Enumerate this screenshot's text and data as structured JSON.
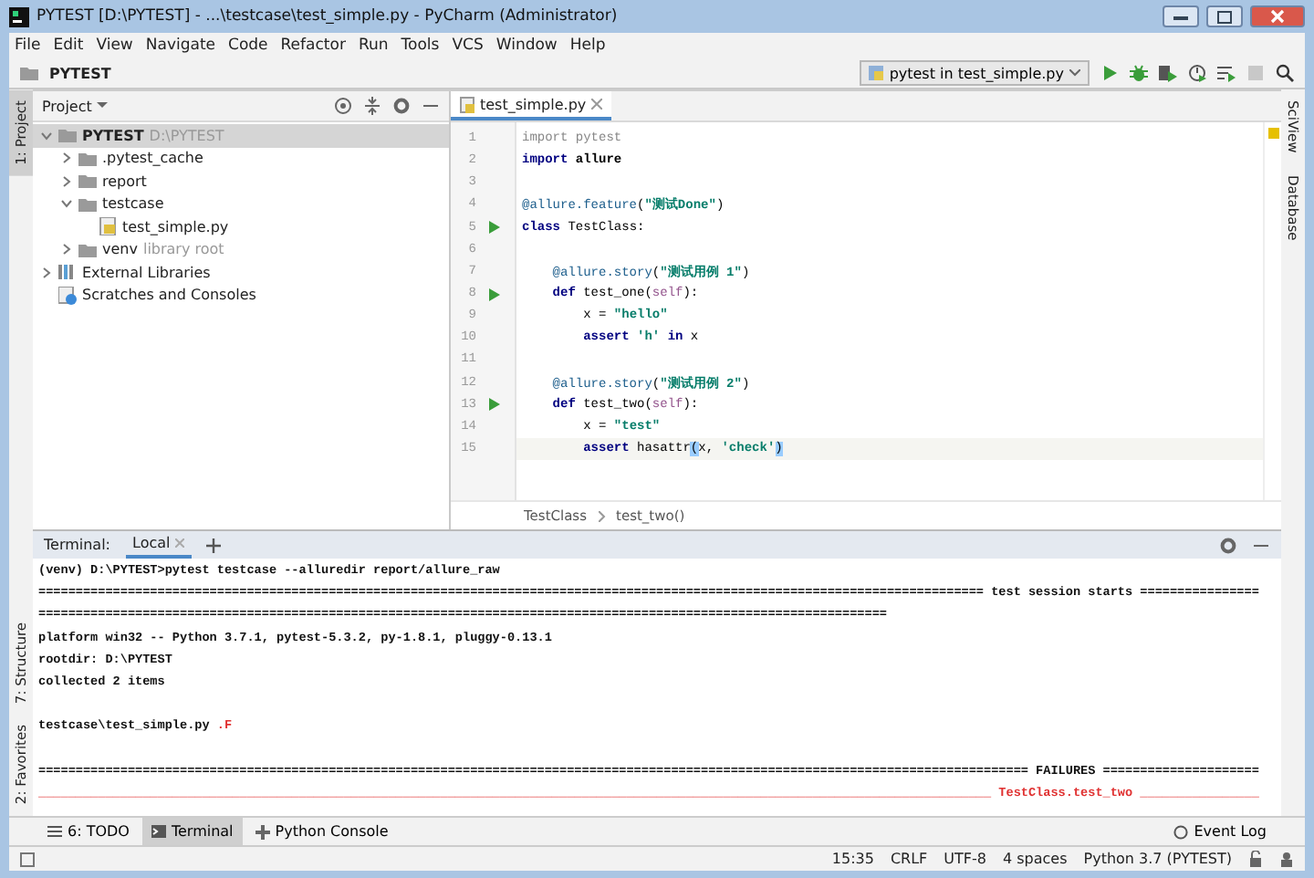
{
  "window": {
    "title": "PYTEST [D:\\PYTEST] - ...\\testcase\\test_simple.py - PyCharm (Administrator)"
  },
  "menu": [
    "File",
    "Edit",
    "View",
    "Navigate",
    "Code",
    "Refactor",
    "Run",
    "Tools",
    "VCS",
    "Window",
    "Help"
  ],
  "navbar": {
    "breadcrumb": "PYTEST",
    "run_config": "pytest in test_simple.py"
  },
  "left_tools": [
    {
      "label": "1: Project",
      "selected": true
    }
  ],
  "left_tools_bottom": [
    {
      "label": "7: Structure"
    },
    {
      "label": "2: Favorites"
    }
  ],
  "right_tools": [
    {
      "label": "SciView"
    },
    {
      "label": "Database"
    }
  ],
  "project": {
    "title": "Project",
    "tree": [
      {
        "label": "PYTEST",
        "hint": "D:\\PYTEST",
        "kind": "folder",
        "expanded": true,
        "selected": true,
        "children": [
          {
            "label": ".pytest_cache",
            "kind": "folder",
            "expanded": false,
            "selected": false
          },
          {
            "label": "report",
            "kind": "folder",
            "expanded": false,
            "selected": false
          },
          {
            "label": "testcase",
            "kind": "folder",
            "expanded": true,
            "selected": false,
            "children": [
              {
                "label": "test_simple.py",
                "kind": "file",
                "selected": false
              }
            ]
          },
          {
            "label": "venv",
            "hint": "library root",
            "kind": "folder",
            "expanded": false,
            "selected": false
          }
        ]
      },
      {
        "label": "External Libraries",
        "kind": "libraries",
        "expanded": false,
        "selected": false
      },
      {
        "label": "Scratches and Consoles",
        "kind": "scratches",
        "selected": false
      }
    ]
  },
  "editor": {
    "tabs": [
      {
        "label": "test_simple.py",
        "selected": true
      }
    ],
    "lines": [
      {
        "number": "1",
        "run": false,
        "current": false,
        "tokens": [
          {
            "kind": "unused",
            "text": "import pytest"
          }
        ]
      },
      {
        "number": "2",
        "run": false,
        "current": false,
        "tokens": [
          {
            "kind": "keyword",
            "text": "import"
          },
          {
            "kind": "name",
            "text": " allure"
          }
        ]
      },
      {
        "number": "3",
        "run": false,
        "current": false
      },
      {
        "number": "4",
        "run": false,
        "current": false,
        "tokens": [
          {
            "kind": "decorator",
            "text": "@allure.feature"
          },
          {
            "kind": "plain",
            "text": "("
          },
          {
            "kind": "string",
            "text": "\"测试Done\""
          },
          {
            "kind": "plain",
            "text": ")"
          }
        ]
      },
      {
        "number": "5",
        "run": true,
        "current": false,
        "tokens": [
          {
            "kind": "keyword",
            "text": "class"
          },
          {
            "kind": "plain",
            "text": " TestClass:"
          }
        ]
      },
      {
        "number": "6",
        "run": false,
        "current": false
      },
      {
        "number": "7",
        "run": false,
        "current": false,
        "tokens": [
          {
            "kind": "decorator",
            "text": "    @allure.story"
          },
          {
            "kind": "plain",
            "text": "("
          },
          {
            "kind": "string",
            "text": "\"测试用例 1\""
          },
          {
            "kind": "plain",
            "text": ")"
          }
        ]
      },
      {
        "number": "8",
        "run": true,
        "current": false,
        "tokens": [
          {
            "kind": "keyword",
            "text": "    def"
          },
          {
            "kind": "plain",
            "text": " test_one("
          },
          {
            "kind": "self",
            "text": "self"
          },
          {
            "kind": "plain",
            "text": "):"
          }
        ]
      },
      {
        "number": "9",
        "run": false,
        "current": false,
        "tokens": [
          {
            "kind": "plain",
            "text": "        x = "
          },
          {
            "kind": "string",
            "text": "\"hello\""
          }
        ]
      },
      {
        "number": "10",
        "run": false,
        "current": false,
        "tokens": [
          {
            "kind": "keyword",
            "text": "        assert"
          },
          {
            "kind": "string",
            "text": " 'h' "
          },
          {
            "kind": "keyword",
            "text": "in"
          },
          {
            "kind": "plain",
            "text": " x"
          }
        ]
      },
      {
        "number": "11",
        "run": false,
        "current": false
      },
      {
        "number": "12",
        "run": false,
        "current": false,
        "tokens": [
          {
            "kind": "decorator",
            "text": "    @allure.story"
          },
          {
            "kind": "plain",
            "text": "("
          },
          {
            "kind": "string",
            "text": "\"测试用例 2\""
          },
          {
            "kind": "plain",
            "text": ")"
          }
        ]
      },
      {
        "number": "13",
        "run": true,
        "current": false,
        "tokens": [
          {
            "kind": "keyword",
            "text": "    def"
          },
          {
            "kind": "plain",
            "text": " test_two("
          },
          {
            "kind": "self",
            "text": "self"
          },
          {
            "kind": "plain",
            "text": "):"
          }
        ]
      },
      {
        "number": "14",
        "run": false,
        "current": false,
        "tokens": [
          {
            "kind": "plain",
            "text": "        x = "
          },
          {
            "kind": "string",
            "text": "\"test\""
          }
        ]
      },
      {
        "number": "15",
        "run": false,
        "current": true,
        "tokens": [
          {
            "kind": "keyword",
            "text": "        assert"
          },
          {
            "kind": "plain",
            "text": " hasattr"
          },
          {
            "kind": "match",
            "text": "("
          },
          {
            "kind": "plain",
            "text": "x, "
          },
          {
            "kind": "string",
            "text": "'check'"
          },
          {
            "kind": "match",
            "text": ")"
          }
        ]
      }
    ],
    "breadcrumbs": [
      "TestClass",
      "test_two()"
    ]
  },
  "terminal": {
    "label": "Terminal:",
    "tabs": [
      {
        "label": "Local",
        "selected": true
      }
    ],
    "lines": [
      {
        "kind": "normal",
        "text": "(venv) D:\\PYTEST>pytest testcase --alluredir report/allure_raw"
      },
      {
        "kind": "normal",
        "text": "=============================================================================================================================== test session starts ================"
      },
      {
        "kind": "normal",
        "text": "=================================================================================================================="
      },
      {
        "kind": "normal",
        "text": "platform win32 -- Python 3.7.1, pytest-5.3.2, py-1.8.1, pluggy-0.13.1"
      },
      {
        "kind": "normal",
        "text": "rootdir: D:\\PYTEST"
      },
      {
        "kind": "normal",
        "text": "collected 2 items"
      },
      {
        "kind": "blank"
      },
      {
        "kind": "result",
        "text": "testcase\\test_simple.py ",
        "status": ".F"
      },
      {
        "kind": "blank"
      },
      {
        "kind": "normal",
        "text": "===================================================================================================================================== FAILURES ====================="
      },
      {
        "kind": "error",
        "text": "________________________________________________________________________________________________________________________________ TestClass.test_two ________________"
      }
    ]
  },
  "tool_tabs": [
    {
      "label": "6: TODO",
      "kind": "list",
      "selected": false
    },
    {
      "label": "Terminal",
      "kind": "terminal",
      "selected": true
    },
    {
      "label": "Python Console",
      "kind": "python",
      "selected": false
    }
  ],
  "event_log": "Event Log",
  "status_bar": [
    "15:35",
    "CRLF",
    "UTF-8",
    "4 spaces",
    "Python 3.7 (PYTEST)"
  ]
}
